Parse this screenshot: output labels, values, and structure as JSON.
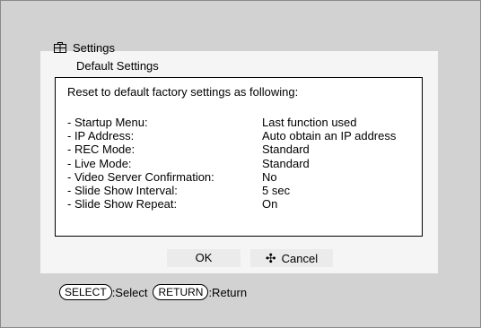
{
  "header": {
    "title": "Settings",
    "icon": "toolbox-icon"
  },
  "subtitle": "Default Settings",
  "intro": "Reset to default factory settings as following:",
  "settings": [
    {
      "key": "- Startup Menu:",
      "value": "Last function used"
    },
    {
      "key": "- IP Address:",
      "value": "Auto obtain an IP address"
    },
    {
      "key": "- REC Mode:",
      "value": "Standard"
    },
    {
      "key": "- Live Mode:",
      "value": "Standard"
    },
    {
      "key": "- Video Server Confirmation:",
      "value": "No"
    },
    {
      "key": "- Slide Show Interval:",
      "value": "5 sec"
    },
    {
      "key": "- Slide Show Repeat:",
      "value": "On"
    }
  ],
  "buttons": {
    "ok": "OK",
    "cancel": "Cancel"
  },
  "footer": {
    "select_key": "SELECT",
    "select_text": ":Select",
    "return_key": "RETURN",
    "return_text": ":Return"
  }
}
